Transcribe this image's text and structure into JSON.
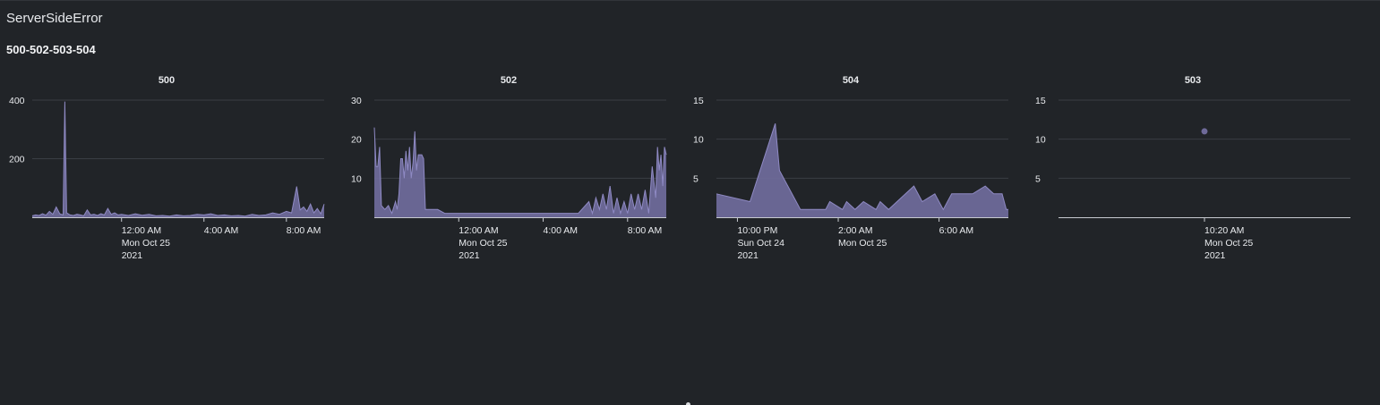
{
  "dashboard": {
    "title": "ServerSideError",
    "panel_title": "500-502-503-504"
  },
  "colors": {
    "background": "#212428",
    "series_fill": "#6e6a99",
    "series_stroke": "#8f8ac4",
    "gridline": "#3a3e44",
    "axis": "#c7cad0",
    "text": "#e8eaed"
  },
  "chart_data": [
    {
      "type": "area",
      "title": "500",
      "xlabel": "",
      "ylabel": "",
      "x_time_range": [
        "2021-10-24 19:40",
        "2021-10-25 09:50"
      ],
      "ylim": [
        0,
        400
      ],
      "yticks": [
        200,
        400
      ],
      "xticks": [
        {
          "time": "2021-10-25 00:00",
          "lines": [
            "12:00 AM",
            "Mon Oct 25",
            "2021"
          ]
        },
        {
          "time": "2021-10-25 04:00",
          "lines": [
            "4:00 AM"
          ]
        },
        {
          "time": "2021-10-25 08:00",
          "lines": [
            "8:00 AM"
          ]
        }
      ],
      "grid": true,
      "points": [
        [
          "2021-10-24 19:40",
          5
        ],
        [
          "2021-10-24 19:50",
          8
        ],
        [
          "2021-10-24 20:00",
          6
        ],
        [
          "2021-10-24 20:10",
          12
        ],
        [
          "2021-10-24 20:20",
          7
        ],
        [
          "2021-10-24 20:30",
          20
        ],
        [
          "2021-10-24 20:40",
          10
        ],
        [
          "2021-10-24 20:50",
          35
        ],
        [
          "2021-10-24 21:00",
          12
        ],
        [
          "2021-10-24 21:10",
          8
        ],
        [
          "2021-10-24 21:15",
          395
        ],
        [
          "2021-10-24 21:20",
          15
        ],
        [
          "2021-10-24 21:30",
          8
        ],
        [
          "2021-10-24 21:40",
          6
        ],
        [
          "2021-10-24 21:50",
          10
        ],
        [
          "2021-10-24 22:00",
          8
        ],
        [
          "2021-10-24 22:10",
          5
        ],
        [
          "2021-10-24 22:20",
          25
        ],
        [
          "2021-10-24 22:30",
          8
        ],
        [
          "2021-10-24 22:40",
          10
        ],
        [
          "2021-10-24 22:50",
          6
        ],
        [
          "2021-10-24 23:00",
          12
        ],
        [
          "2021-10-24 23:10",
          8
        ],
        [
          "2021-10-24 23:20",
          30
        ],
        [
          "2021-10-24 23:30",
          10
        ],
        [
          "2021-10-24 23:40",
          15
        ],
        [
          "2021-10-24 23:50",
          8
        ],
        [
          "2021-10-25 00:00",
          10
        ],
        [
          "2021-10-25 00:20",
          6
        ],
        [
          "2021-10-25 00:40",
          12
        ],
        [
          "2021-10-25 01:00",
          7
        ],
        [
          "2021-10-25 01:20",
          10
        ],
        [
          "2021-10-25 01:40",
          5
        ],
        [
          "2021-10-25 02:00",
          6
        ],
        [
          "2021-10-25 02:20",
          4
        ],
        [
          "2021-10-25 02:40",
          8
        ],
        [
          "2021-10-25 03:00",
          5
        ],
        [
          "2021-10-25 03:20",
          6
        ],
        [
          "2021-10-25 03:40",
          10
        ],
        [
          "2021-10-25 04:00",
          8
        ],
        [
          "2021-10-25 04:20",
          12
        ],
        [
          "2021-10-25 04:40",
          6
        ],
        [
          "2021-10-25 05:00",
          8
        ],
        [
          "2021-10-25 05:20",
          5
        ],
        [
          "2021-10-25 05:40",
          6
        ],
        [
          "2021-10-25 06:00",
          4
        ],
        [
          "2021-10-25 06:20",
          10
        ],
        [
          "2021-10-25 06:40",
          6
        ],
        [
          "2021-10-25 07:00",
          8
        ],
        [
          "2021-10-25 07:20",
          15
        ],
        [
          "2021-10-25 07:40",
          10
        ],
        [
          "2021-10-25 08:00",
          20
        ],
        [
          "2021-10-25 08:15",
          15
        ],
        [
          "2021-10-25 08:30",
          105
        ],
        [
          "2021-10-25 08:40",
          25
        ],
        [
          "2021-10-25 08:50",
          35
        ],
        [
          "2021-10-25 09:00",
          20
        ],
        [
          "2021-10-25 09:10",
          45
        ],
        [
          "2021-10-25 09:20",
          15
        ],
        [
          "2021-10-25 09:30",
          30
        ],
        [
          "2021-10-25 09:40",
          12
        ],
        [
          "2021-10-25 09:50",
          45
        ]
      ]
    },
    {
      "type": "area",
      "title": "502",
      "xlabel": "",
      "ylabel": "",
      "x_time_range": [
        "2021-10-24 20:00",
        "2021-10-25 09:50"
      ],
      "ylim": [
        0,
        30
      ],
      "yticks": [
        10,
        20,
        30
      ],
      "xticks": [
        {
          "time": "2021-10-25 00:00",
          "lines": [
            "12:00 AM",
            "Mon Oct 25",
            "2021"
          ]
        },
        {
          "time": "2021-10-25 04:00",
          "lines": [
            "4:00 AM"
          ]
        },
        {
          "time": "2021-10-25 08:00",
          "lines": [
            "8:00 AM"
          ]
        }
      ],
      "grid": true,
      "points": [
        [
          "2021-10-24 20:00",
          23
        ],
        [
          "2021-10-24 20:05",
          13
        ],
        [
          "2021-10-24 20:10",
          13
        ],
        [
          "2021-10-24 20:15",
          18
        ],
        [
          "2021-10-24 20:20",
          3
        ],
        [
          "2021-10-24 20:30",
          2
        ],
        [
          "2021-10-24 20:40",
          3
        ],
        [
          "2021-10-24 20:50",
          1
        ],
        [
          "2021-10-24 21:00",
          4
        ],
        [
          "2021-10-24 21:05",
          2
        ],
        [
          "2021-10-24 21:10",
          6
        ],
        [
          "2021-10-24 21:15",
          15
        ],
        [
          "2021-10-24 21:20",
          15
        ],
        [
          "2021-10-24 21:25",
          10
        ],
        [
          "2021-10-24 21:30",
          17
        ],
        [
          "2021-10-24 21:35",
          12
        ],
        [
          "2021-10-24 21:40",
          18
        ],
        [
          "2021-10-24 21:45",
          10
        ],
        [
          "2021-10-24 21:50",
          14
        ],
        [
          "2021-10-24 21:55",
          22
        ],
        [
          "2021-10-24 22:00",
          12
        ],
        [
          "2021-10-24 22:05",
          16
        ],
        [
          "2021-10-24 22:15",
          16
        ],
        [
          "2021-10-24 22:20",
          15
        ],
        [
          "2021-10-24 22:25",
          2
        ],
        [
          "2021-10-24 22:40",
          2
        ],
        [
          "2021-10-24 23:00",
          2
        ],
        [
          "2021-10-24 23:20",
          1
        ],
        [
          "2021-10-25 00:00",
          1
        ],
        [
          "2021-10-25 02:00",
          1
        ],
        [
          "2021-10-25 04:00",
          1
        ],
        [
          "2021-10-25 05:40",
          1
        ],
        [
          "2021-10-25 06:10",
          4
        ],
        [
          "2021-10-25 06:20",
          1
        ],
        [
          "2021-10-25 06:30",
          5
        ],
        [
          "2021-10-25 06:40",
          2
        ],
        [
          "2021-10-25 06:50",
          6
        ],
        [
          "2021-10-25 07:00",
          2
        ],
        [
          "2021-10-25 07:10",
          8
        ],
        [
          "2021-10-25 07:20",
          1
        ],
        [
          "2021-10-25 07:30",
          5
        ],
        [
          "2021-10-25 07:40",
          1
        ],
        [
          "2021-10-25 07:50",
          4
        ],
        [
          "2021-10-25 08:00",
          1
        ],
        [
          "2021-10-25 08:10",
          6
        ],
        [
          "2021-10-25 08:20",
          2
        ],
        [
          "2021-10-25 08:30",
          6
        ],
        [
          "2021-10-25 08:40",
          2
        ],
        [
          "2021-10-25 08:50",
          7
        ],
        [
          "2021-10-25 09:00",
          1
        ],
        [
          "2021-10-25 09:10",
          13
        ],
        [
          "2021-10-25 09:20",
          5
        ],
        [
          "2021-10-25 09:25",
          18
        ],
        [
          "2021-10-25 09:30",
          12
        ],
        [
          "2021-10-25 09:35",
          16
        ],
        [
          "2021-10-25 09:40",
          8
        ],
        [
          "2021-10-25 09:45",
          18
        ],
        [
          "2021-10-25 09:50",
          16
        ]
      ]
    },
    {
      "type": "area",
      "title": "504",
      "xlabel": "",
      "ylabel": "",
      "x_time_range": [
        "2021-10-24 21:10",
        "2021-10-25 08:45"
      ],
      "ylim": [
        0,
        15
      ],
      "yticks": [
        5,
        10,
        15
      ],
      "xticks": [
        {
          "time": "2021-10-24 22:00",
          "lines": [
            "10:00 PM",
            "Sun Oct 24",
            "2021"
          ]
        },
        {
          "time": "2021-10-25 02:00",
          "lines": [
            "2:00 AM",
            "Mon Oct 25"
          ]
        },
        {
          "time": "2021-10-25 06:00",
          "lines": [
            "6:00 AM"
          ]
        }
      ],
      "grid": true,
      "points": [
        [
          "2021-10-24 21:10",
          3
        ],
        [
          "2021-10-24 22:30",
          2
        ],
        [
          "2021-10-24 23:30",
          12
        ],
        [
          "2021-10-24 23:40",
          6
        ],
        [
          "2021-10-25 00:30",
          1
        ],
        [
          "2021-10-25 01:30",
          1
        ],
        [
          "2021-10-25 01:40",
          2
        ],
        [
          "2021-10-25 02:10",
          1
        ],
        [
          "2021-10-25 02:20",
          2
        ],
        [
          "2021-10-25 02:40",
          1
        ],
        [
          "2021-10-25 03:00",
          2
        ],
        [
          "2021-10-25 03:30",
          1
        ],
        [
          "2021-10-25 03:40",
          2
        ],
        [
          "2021-10-25 04:00",
          1
        ],
        [
          "2021-10-25 05:00",
          4
        ],
        [
          "2021-10-25 05:20",
          2
        ],
        [
          "2021-10-25 05:50",
          3
        ],
        [
          "2021-10-25 06:10",
          1
        ],
        [
          "2021-10-25 06:30",
          3
        ],
        [
          "2021-10-25 07:20",
          3
        ],
        [
          "2021-10-25 07:50",
          4
        ],
        [
          "2021-10-25 08:10",
          3
        ],
        [
          "2021-10-25 08:30",
          3
        ],
        [
          "2021-10-25 08:40",
          1
        ],
        [
          "2021-10-25 08:45",
          1
        ]
      ]
    },
    {
      "type": "scatter",
      "title": "503",
      "xlabel": "",
      "ylabel": "",
      "x_time_range": [
        "2021-10-25 10:10",
        "2021-10-25 10:30"
      ],
      "ylim": [
        0,
        15
      ],
      "yticks": [
        5,
        10,
        15
      ],
      "xticks": [
        {
          "time": "2021-10-25 10:20",
          "lines": [
            "10:20 AM",
            "Mon Oct 25",
            "2021"
          ]
        }
      ],
      "grid": true,
      "points": [
        [
          "2021-10-25 10:20",
          11
        ]
      ]
    }
  ]
}
